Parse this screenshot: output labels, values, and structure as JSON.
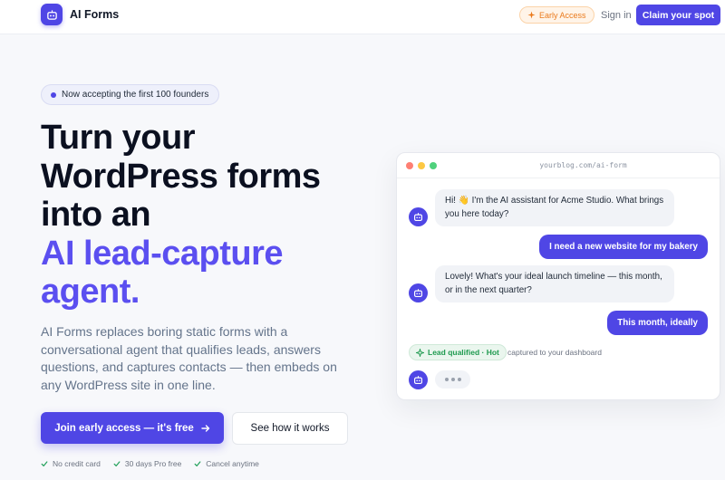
{
  "nav": {
    "brand": "AI Forms",
    "early_access": "Early Access",
    "sign_in": "Sign in",
    "claim": "Claim your spot"
  },
  "hero": {
    "pill": "Now accepting the first 100 founders",
    "headline_lines": [
      "Turn your",
      "WordPress forms",
      "into an"
    ],
    "headline_accent_lines": [
      "AI lead-capture",
      "agent."
    ],
    "subtext": "AI Forms replaces boring static forms with a conversational agent that qualifies leads, answers questions, and captures contacts — then embeds on any WordPress site in one line.",
    "cta_primary": "Join early access — it's free",
    "cta_secondary": "See how it works",
    "checks": [
      "No credit card",
      "30 days Pro free",
      "Cancel anytime"
    ]
  },
  "chat": {
    "url": "yourblog.com/ai-form",
    "messages": [
      {
        "role": "assistant",
        "text": "Hi! 👋 I'm the AI assistant for Acme Studio. What brings you here today?"
      },
      {
        "role": "user",
        "text": "I need a new website for my bakery"
      },
      {
        "role": "assistant",
        "text": "Lovely! What's your ideal launch timeline — this month, or in the next quarter?"
      },
      {
        "role": "user",
        "text": "This month, ideally"
      }
    ],
    "lead_badge": "Lead qualified · Hot",
    "captured": "captured to your dashboard"
  },
  "colors": {
    "accent": "#4f46e5",
    "accent_text": "#5b4ff0",
    "success": "#1e9a4f",
    "warning": "#ea7a1c",
    "traffic_red": "#fe7f73",
    "traffic_yellow": "#fdc843",
    "traffic_green": "#4fd17c"
  },
  "icons": {
    "logo": "robot-icon",
    "early_access": "sparkle-icon",
    "cta_arrow": "arrow-right-icon",
    "check": "check-icon",
    "lead": "sparkle-icon"
  }
}
